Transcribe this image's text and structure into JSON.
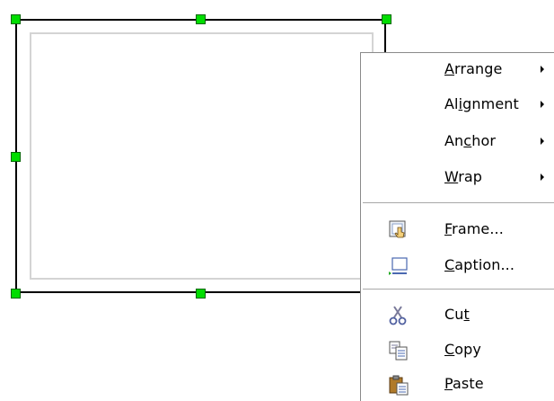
{
  "menu": {
    "items": [
      {
        "id": "arrange",
        "pre": "",
        "key": "A",
        "post": "rrange",
        "submenu": true
      },
      {
        "id": "alignment",
        "pre": "Al",
        "key": "i",
        "post": "gnment",
        "submenu": true
      },
      {
        "id": "anchor",
        "pre": "An",
        "key": "c",
        "post": "hor",
        "submenu": true
      },
      {
        "id": "wrap",
        "pre": "",
        "key": "W",
        "post": "rap",
        "submenu": true
      },
      {
        "id": "frame",
        "pre": "",
        "key": "F",
        "post": "rame...",
        "icon": "frame-properties-icon"
      },
      {
        "id": "caption",
        "pre": "",
        "key": "C",
        "post": "aption...",
        "icon": "caption-icon"
      },
      {
        "id": "cut",
        "pre": "Cu",
        "key": "t",
        "post": "",
        "icon": "scissors-icon"
      },
      {
        "id": "copy",
        "pre": "",
        "key": "C",
        "post": "opy",
        "icon": "copy-icon"
      },
      {
        "id": "paste",
        "pre": "",
        "key": "P",
        "post": "aste",
        "icon": "paste-icon"
      }
    ]
  },
  "colors": {
    "handle": "#00dd00",
    "frame_border": "#000000",
    "inner_border": "#d4d4d4",
    "menu_border": "#8a8a8a"
  }
}
